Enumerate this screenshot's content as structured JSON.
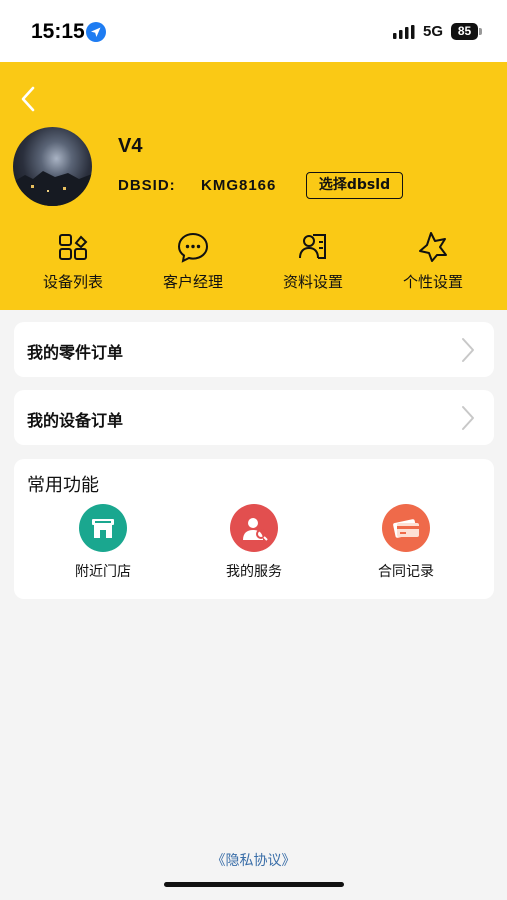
{
  "status_bar": {
    "time": "15:15",
    "network": "5G",
    "battery": "85"
  },
  "header": {
    "background_color": "#fac915",
    "username": "V4",
    "dbsid_label": "DBSID:",
    "dbsid_value": "KMG8166",
    "select_dbsid_label": "选择dbsld",
    "quick_actions": [
      {
        "label": "设备列表",
        "icon": "device-list-icon"
      },
      {
        "label": "客户经理",
        "icon": "chat-bubble-icon"
      },
      {
        "label": "资料设置",
        "icon": "profile-card-icon"
      },
      {
        "label": "个性设置",
        "icon": "star-icon"
      }
    ]
  },
  "orders": [
    {
      "label": "我的零件订单"
    },
    {
      "label": "我的设备订单"
    }
  ],
  "functions": {
    "title": "常用功能",
    "items": [
      {
        "label": "附近门店",
        "icon": "store-icon",
        "color": "#1aa78f"
      },
      {
        "label": "我的服务",
        "icon": "service-agent-icon",
        "color": "#e24f4f"
      },
      {
        "label": "合同记录",
        "icon": "card-icon",
        "color": "#ef6a4a"
      }
    ]
  },
  "footer": {
    "privacy_label": "《隐私协议》"
  }
}
